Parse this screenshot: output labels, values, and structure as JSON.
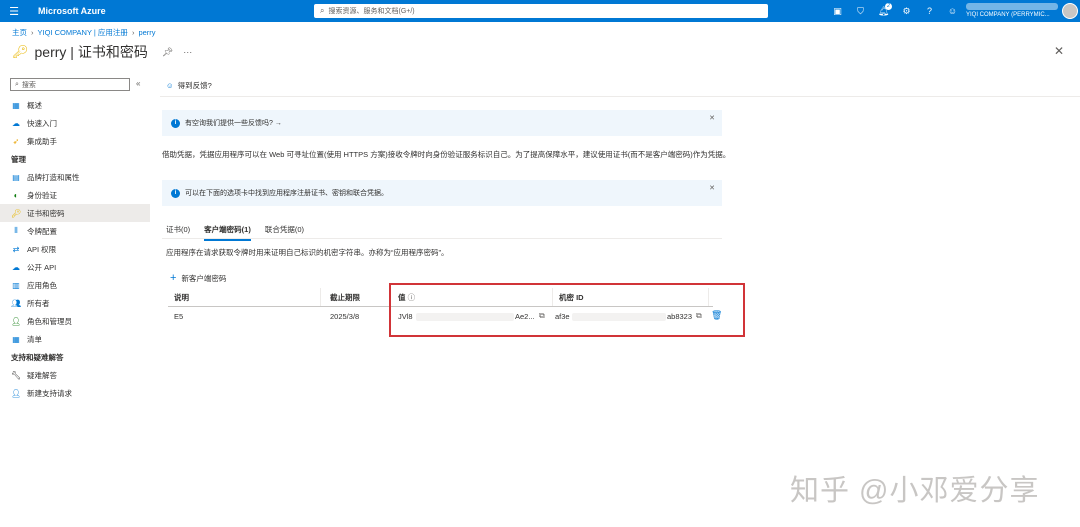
{
  "topbar": {
    "brand": "Microsoft Azure",
    "search_placeholder": "搜索资源、服务和文档(G+/)",
    "notification_count": "2",
    "account_tenant": "YIQI COMPANY (PERRYMIC..."
  },
  "breadcrumb": [
    "主页",
    "YIQI COMPANY | 应用注册",
    "perry"
  ],
  "page": {
    "title": "perry | 证书和密码"
  },
  "sidebar": {
    "search_placeholder": "搜索",
    "items": [
      {
        "label": "概述",
        "icon": "grid-icon"
      },
      {
        "label": "快速入门",
        "icon": "rocket-icon"
      },
      {
        "label": "集成助手",
        "icon": "rocket-icon"
      }
    ],
    "manage_section": "管理",
    "manage_items": [
      {
        "label": "品牌打造和属性",
        "icon": "branding-icon"
      },
      {
        "label": "身份验证",
        "icon": "auth-icon"
      },
      {
        "label": "证书和密码",
        "icon": "key-icon",
        "active": true
      },
      {
        "label": "令牌配置",
        "icon": "token-icon"
      },
      {
        "label": "API 权限",
        "icon": "api-icon"
      },
      {
        "label": "公开 API",
        "icon": "cloud-icon"
      },
      {
        "label": "应用角色",
        "icon": "roles-icon"
      },
      {
        "label": "所有者",
        "icon": "owners-icon"
      },
      {
        "label": "角色和管理员",
        "icon": "admin-icon"
      },
      {
        "label": "清单",
        "icon": "manifest-icon"
      }
    ],
    "support_section": "支持和疑难解答",
    "support_items": [
      {
        "label": "疑难解答",
        "icon": "wrench-icon"
      },
      {
        "label": "新建支持请求",
        "icon": "support-icon"
      }
    ]
  },
  "main": {
    "feedback_label": "得到反馈?",
    "info1": "有空询我们提供一些反馈吗? →",
    "description": "借助凭据，凭据应用程序可以在 Web 可寻址位置(使用 HTTPS 方案)接收令牌时向身份验证服务标识自己。为了提高保障水平，建议使用证书(而不是客户端密码)作为凭据。",
    "info2": "可以在下面的选项卡中找到应用程序注册证书、密钥和联合凭据。",
    "tabs": [
      "证书(0)",
      "客户端密码(1)",
      "联合凭据(0)"
    ],
    "tab_description": "应用程序在请求获取令牌时用来证明自己标识的机密字符串。亦称为“应用程序密码”。",
    "new_secret_label": "新客户端密码",
    "table": {
      "headers": [
        "说明",
        "截止期限",
        "值",
        "机密 ID"
      ],
      "row": {
        "description": "E5",
        "expires": "2025/3/8",
        "value_prefix": "JVl8",
        "value_suffix": "Ae2...",
        "secret_prefix": "af3e",
        "secret_suffix": "ab8323"
      }
    }
  },
  "watermark": "知乎 @小邓爱分享"
}
